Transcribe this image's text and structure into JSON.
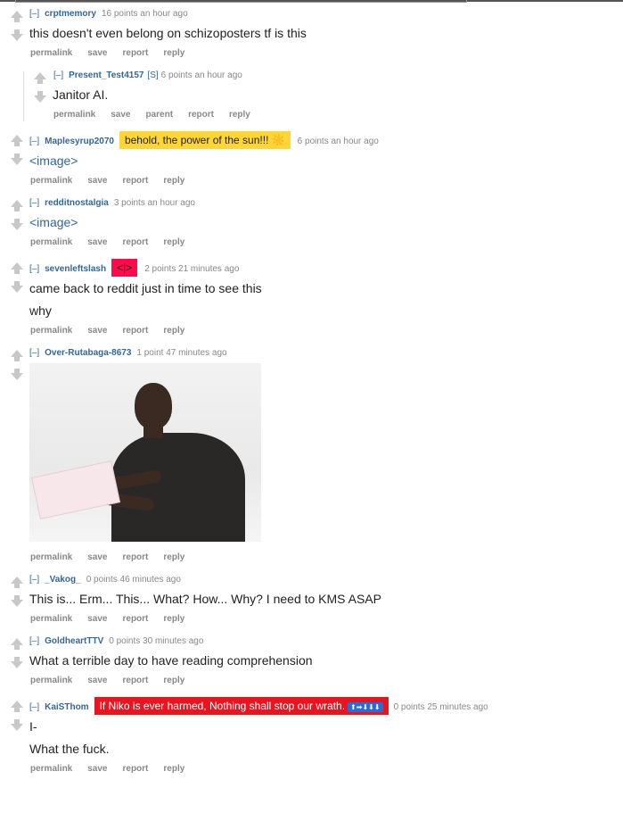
{
  "comments": [
    {
      "toggle": "[–]",
      "author": "crptmemory",
      "meta": "16 points an hour ago",
      "body": [
        "this doesn't even belong on schizoposters tf is this"
      ],
      "buttons": [
        "permalink",
        "save",
        "report",
        "reply"
      ]
    },
    {
      "toggle": "[–]",
      "author": "Present_Test4157",
      "badge": "[S]",
      "meta": "6 points an hour ago",
      "body": [
        "Janitor AI."
      ],
      "buttons": [
        "permalink",
        "save",
        "parent",
        "report",
        "reply"
      ]
    },
    {
      "toggle": "[–]",
      "author": "Maplesyrup2070",
      "flair": "behold, the power of the sun!!! ☀️",
      "meta": "6 points an hour ago",
      "body": [
        "<image>"
      ],
      "buttons": [
        "permalink",
        "save",
        "report",
        "reply"
      ]
    },
    {
      "toggle": "[–]",
      "author": "redditnostalgia",
      "meta": "3 points an hour ago",
      "body": [
        "<image>"
      ],
      "buttons": [
        "permalink",
        "save",
        "report",
        "reply"
      ]
    },
    {
      "toggle": "[–]",
      "author": "sevenleftslash",
      "flair": "<|>",
      "meta": "2 points 21 minutes ago",
      "body": [
        "came back to reddit just in time to see this",
        "why"
      ],
      "buttons": [
        "permalink",
        "save",
        "report",
        "reply"
      ]
    },
    {
      "toggle": "[–]",
      "author": "Over-Rutabaga-8673",
      "meta": "1 point 47 minutes ago",
      "buttons": [
        "permalink",
        "save",
        "report",
        "reply"
      ]
    },
    {
      "toggle": "[–]",
      "author": "_Vakog_",
      "meta": "0 points 46 minutes ago",
      "body": [
        "This is... Erm... This... What? How... Why? I need to KMS ASAP"
      ],
      "buttons": [
        "permalink",
        "save",
        "report",
        "reply"
      ]
    },
    {
      "toggle": "[–]",
      "author": "GoldheartTTV",
      "meta": "0 points 30 minutes ago",
      "body": [
        "What a terrible day to have reading comprehension"
      ],
      "buttons": [
        "permalink",
        "save",
        "report",
        "reply"
      ]
    },
    {
      "toggle": "[–]",
      "author": "KaiSThom",
      "flair": "If Niko is ever harmed, Nothing shall stop our wrath.",
      "flair_emoji": "⬆➡⬇⬇⬇",
      "meta": "0 points 25 minutes ago",
      "body": [
        "I-",
        "What the fuck."
      ],
      "buttons": [
        "permalink",
        "save",
        "report",
        "reply"
      ]
    }
  ],
  "colors": {
    "link": "#336699",
    "meta": "#888888",
    "flair_yellow": "#ffd635",
    "flair_red": "#ff0a4a"
  },
  "icons": {
    "upvote": "upvote-arrow-icon",
    "downvote": "downvote-arrow-icon"
  }
}
